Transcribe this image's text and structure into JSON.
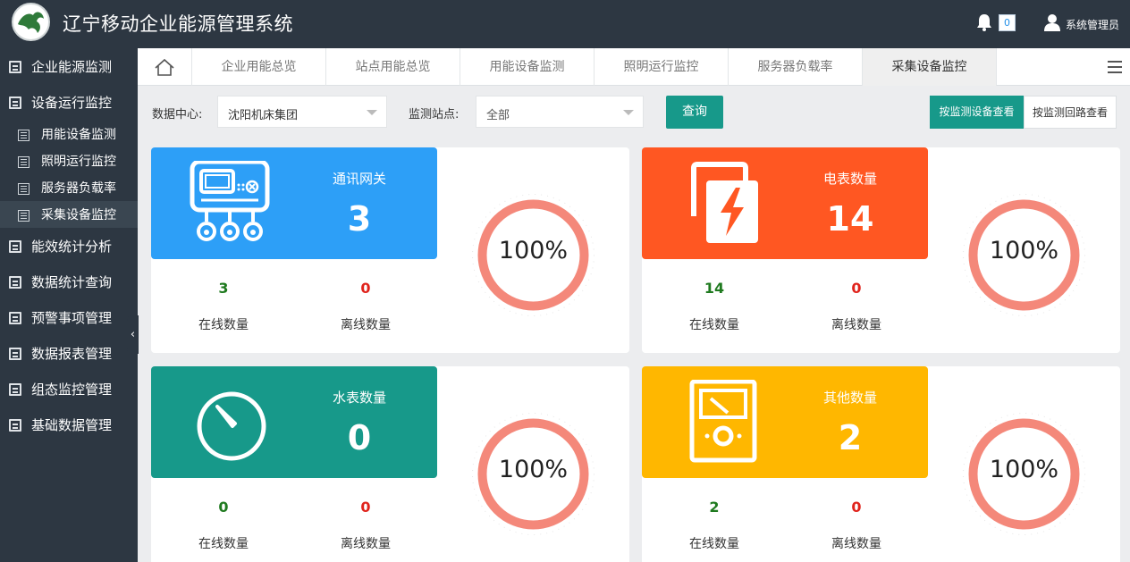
{
  "header": {
    "title": "辽宁移动企业能源管理系统",
    "notification_count": "0",
    "user": "系统管理员"
  },
  "sidebar": {
    "items": [
      {
        "label": "企业能源监测"
      },
      {
        "label": "设备运行监控"
      },
      {
        "label": "能效统计分析"
      },
      {
        "label": "数据统计查询"
      },
      {
        "label": "预警事项管理"
      },
      {
        "label": "数据报表管理"
      },
      {
        "label": "组态监控管理"
      },
      {
        "label": "基础数据管理"
      }
    ],
    "subitems": [
      {
        "label": "用能设备监测"
      },
      {
        "label": "照明运行监控"
      },
      {
        "label": "服务器负载率"
      },
      {
        "label": "采集设备监控",
        "active": true
      }
    ]
  },
  "tabs": [
    {
      "label": "企业用能总览"
    },
    {
      "label": "站点用能总览"
    },
    {
      "label": "用能设备监测"
    },
    {
      "label": "照明运行监控"
    },
    {
      "label": "服务器负载率"
    },
    {
      "label": "采集设备监控",
      "active": true
    }
  ],
  "filters": {
    "datacenter_label": "数据中心:",
    "datacenter_value": "沈阳机床集团",
    "station_label": "监测站点:",
    "station_value": "全部",
    "query_button": "查询",
    "view_by_device": "按监测设备查看",
    "view_by_circuit": "按监测回路查看"
  },
  "colors": {
    "header_bg": "#2d3742",
    "accent": "#17998a",
    "gateway": "#2d9ff7",
    "meter": "#ff5722",
    "water": "#17998a",
    "other": "#ffb700",
    "gauge_ring": "#f4887a",
    "online": "#1f7a1f",
    "offline": "#e0231c"
  },
  "cards": [
    {
      "title": "通讯网关",
      "count": "3",
      "online": "3",
      "offline": "0",
      "online_label": "在线数量",
      "offline_label": "离线数量",
      "percent": "100%",
      "icon": "gateway-icon"
    },
    {
      "title": "电表数量",
      "count": "14",
      "online": "14",
      "offline": "0",
      "online_label": "在线数量",
      "offline_label": "离线数量",
      "percent": "100%",
      "icon": "electric-meter-icon"
    },
    {
      "title": "水表数量",
      "count": "0",
      "online": "0",
      "offline": "0",
      "online_label": "在线数量",
      "offline_label": "离线数量",
      "percent": "100%",
      "icon": "water-meter-icon"
    },
    {
      "title": "其他数量",
      "count": "2",
      "online": "2",
      "offline": "0",
      "online_label": "在线数量",
      "offline_label": "离线数量",
      "percent": "100%",
      "icon": "multimeter-icon"
    }
  ]
}
